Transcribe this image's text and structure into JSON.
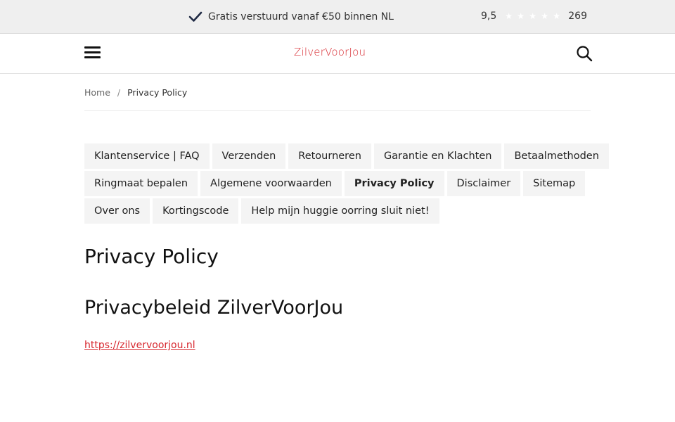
{
  "topbar": {
    "shipping_text": "Gratis verstuurd vanaf €50 binnen NL",
    "rating_score": "9,5",
    "review_count": "269",
    "stars": 5
  },
  "header": {
    "logo_text": "ZilverVoorJou"
  },
  "breadcrumb": {
    "home": "Home",
    "separator": "/",
    "current": "Privacy Policy"
  },
  "tabs": {
    "row1": [
      "Klantenservice | FAQ",
      "Verzenden",
      "Retourneren",
      "Garantie en Klachten",
      "Betaalmethoden"
    ],
    "row2": [
      "Ringmaat bepalen",
      "Algemene voorwaarden",
      "Privacy Policy",
      "Disclaimer",
      "Sitemap"
    ],
    "row3": [
      "Over ons",
      "Kortingscode",
      "Help mijn huggie oorring sluit niet!"
    ],
    "active": "Privacy Policy"
  },
  "content": {
    "title": "Privacy Policy",
    "subtitle": "Privacybeleid ZilverVoorJou",
    "link_text": "https://zilvervoorjou.nl"
  },
  "colors": {
    "brand_red": "#d7262d",
    "topbar_bg": "#efefef",
    "tab_bg": "#f4f4f4"
  }
}
